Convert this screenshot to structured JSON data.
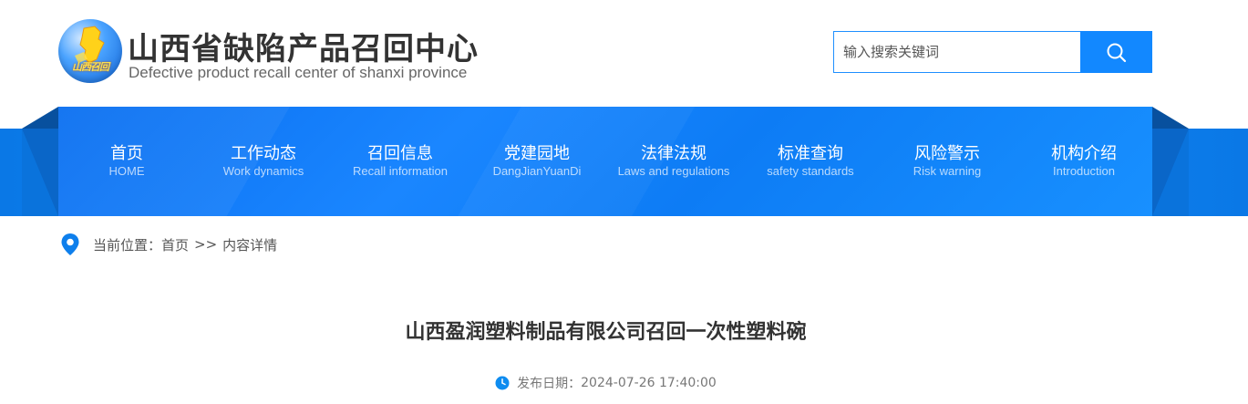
{
  "header": {
    "logo_text": "山西召回",
    "site_title": "山西省缺陷产品召回中心",
    "site_subtitle": "Defective product recall center of shanxi province",
    "search_placeholder": "输入搜索关键词",
    "search_value": "",
    "search_icon": "search-icon"
  },
  "nav": {
    "items": [
      {
        "zh": "首页",
        "en": "HOME"
      },
      {
        "zh": "工作动态",
        "en": "Work dynamics"
      },
      {
        "zh": "召回信息",
        "en": "Recall information"
      },
      {
        "zh": "党建园地",
        "en": "DangJianYuanDi"
      },
      {
        "zh": "法律法规",
        "en": "Laws and regulations"
      },
      {
        "zh": "标准查询",
        "en": "safety standards"
      },
      {
        "zh": "风险警示",
        "en": "Risk warning"
      },
      {
        "zh": "机构介绍",
        "en": "Introduction"
      }
    ]
  },
  "breadcrumb": {
    "icon": "location-pin-icon",
    "label": "当前位置：",
    "home": "首页",
    "separator": ">>",
    "current": "内容详情"
  },
  "article": {
    "title": "山西盈润塑料制品有限公司召回一次性塑料碗",
    "publish_label": "发布日期：",
    "publish_date": "2024-07-26 17:40:00",
    "clock_icon": "clock-icon"
  },
  "colors": {
    "brand_blue": "#1288ff",
    "nav_blue": "#0d7cf5",
    "text_dark": "#333333",
    "text_muted": "#777777"
  }
}
